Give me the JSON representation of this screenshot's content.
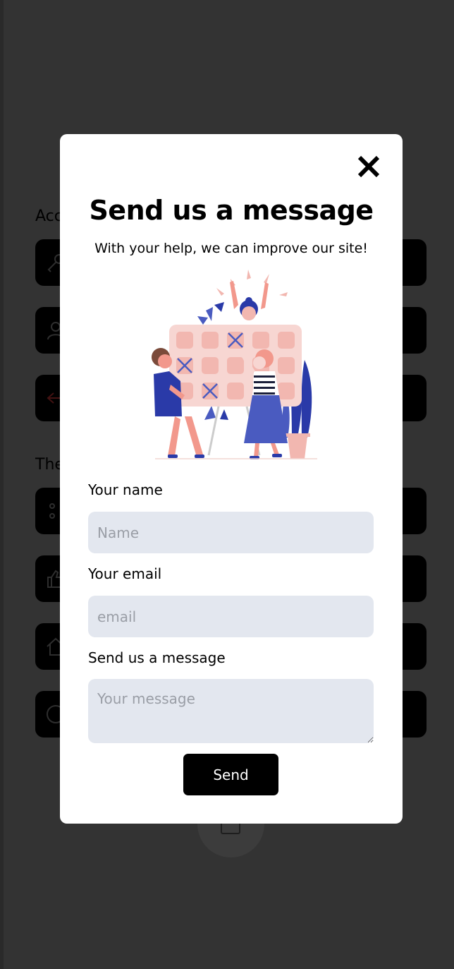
{
  "background": {
    "section_headings": [
      "Acc",
      "The"
    ],
    "rows": [
      {
        "icon": "key-icon"
      },
      {
        "icon": "user-icon"
      },
      {
        "icon": "logout-icon"
      },
      {
        "icon": "dots-icon"
      },
      {
        "icon": "thumbs-up-icon"
      },
      {
        "icon": "home-icon"
      },
      {
        "icon": "chat-icon"
      }
    ],
    "fab_icon": "square-icon"
  },
  "modal": {
    "close_icon": "close-icon",
    "title": "Send us a message",
    "subtitle": "With your help, we can improve our site!",
    "illustration_icon": "calendar-illustration",
    "fields": {
      "name": {
        "label": "Your name",
        "placeholder": "Name"
      },
      "email": {
        "label": "Your email",
        "placeholder": "email"
      },
      "message": {
        "label": "Send us a message",
        "placeholder": "Your message"
      }
    },
    "submit_label": "Send"
  },
  "colors": {
    "overlay": "#333333",
    "modal_bg": "#ffffff",
    "input_bg": "#e3e7ef",
    "accent_blue": "#4a5bc0",
    "accent_pink": "#f2b7b0"
  }
}
